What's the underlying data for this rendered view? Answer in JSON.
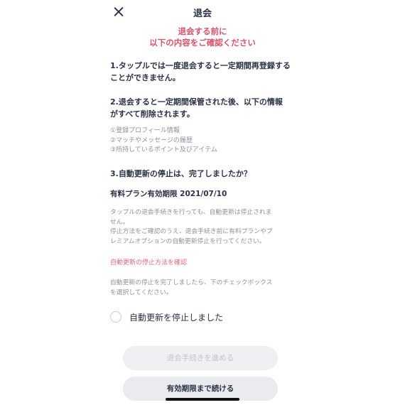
{
  "header": {
    "title": "退会",
    "close_icon": "close-icon"
  },
  "warning": {
    "line1": "退会する前に",
    "line2": "以下の内容をご確認ください"
  },
  "section1": {
    "line1": "1.タップルでは一度退会すると一定期間再登録する",
    "line2": "ことができません。"
  },
  "section2": {
    "line1": "2.退会すると一定期間保管された後、以下の情報",
    "line2": "がすべて削除されます。",
    "items": [
      "①登録プロフィール情報",
      "②マッチやメッセージの履歴",
      "③所持しているポイント及びアイテム"
    ]
  },
  "section3": {
    "heading": "3.自動更新の停止は、完了しましたか？",
    "expiry": "有料プラン有効期限  2021/07/10",
    "note_lines": [
      "タップルの退会手続きを行っても、自動更新は停止されま",
      "せん。",
      "停止方法をご確認のうえ、退会手続き前に有料プランやプ",
      "レミアムオプションの自動更新停止を行ってください。"
    ],
    "link": "自動更新の停止方法を確認",
    "check_note_lines": [
      "自動更新の停止を完了しましたら、下のチェックボックス",
      "を選択してください。"
    ],
    "checkbox_label": "自動更新を停止しました",
    "checkbox_checked": false
  },
  "buttons": {
    "proceed": "退会手続きを進める",
    "proceed_enabled": false,
    "continue": "有効期限まで続ける"
  },
  "colors": {
    "accent": "#d9536a",
    "link": "#e06a7c",
    "text": "#2b3245",
    "muted": "#8d929b"
  }
}
